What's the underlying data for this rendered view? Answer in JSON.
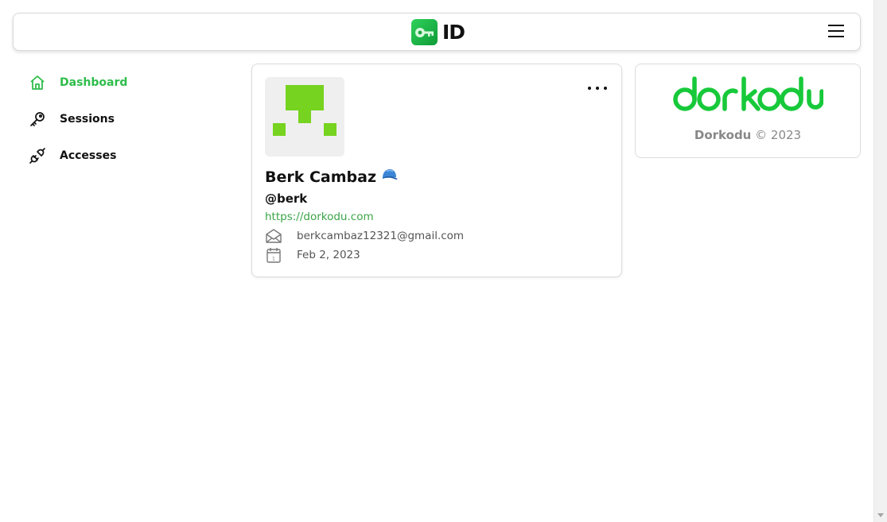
{
  "header": {
    "brand_text": "ID",
    "logo_icon": "key-icon",
    "menu_icon": "hamburger-menu-icon"
  },
  "sidebar": {
    "items": [
      {
        "label": "Dashboard",
        "icon": "home-icon",
        "active": true
      },
      {
        "label": "Sessions",
        "icon": "key-icon",
        "active": false
      },
      {
        "label": "Accesses",
        "icon": "plug-icon",
        "active": false
      }
    ]
  },
  "profile": {
    "name": "Berk Cambaz",
    "name_emoji_icon": "cap-icon",
    "handle": "@berk",
    "website": "https://dorkodu.com",
    "email": "berkcambaz12321@gmail.com",
    "joined": "Feb 2, 2023",
    "more_icon": "more-options-icon"
  },
  "brand_card": {
    "wordmark": "dorkodu",
    "owner": "Dorkodu",
    "copyright_rest": "© 2023"
  },
  "colors": {
    "accent": "#2fbd4b",
    "link": "#3aa447",
    "avatar_green": "#76d31f",
    "wordmark_green": "#17c93a"
  }
}
